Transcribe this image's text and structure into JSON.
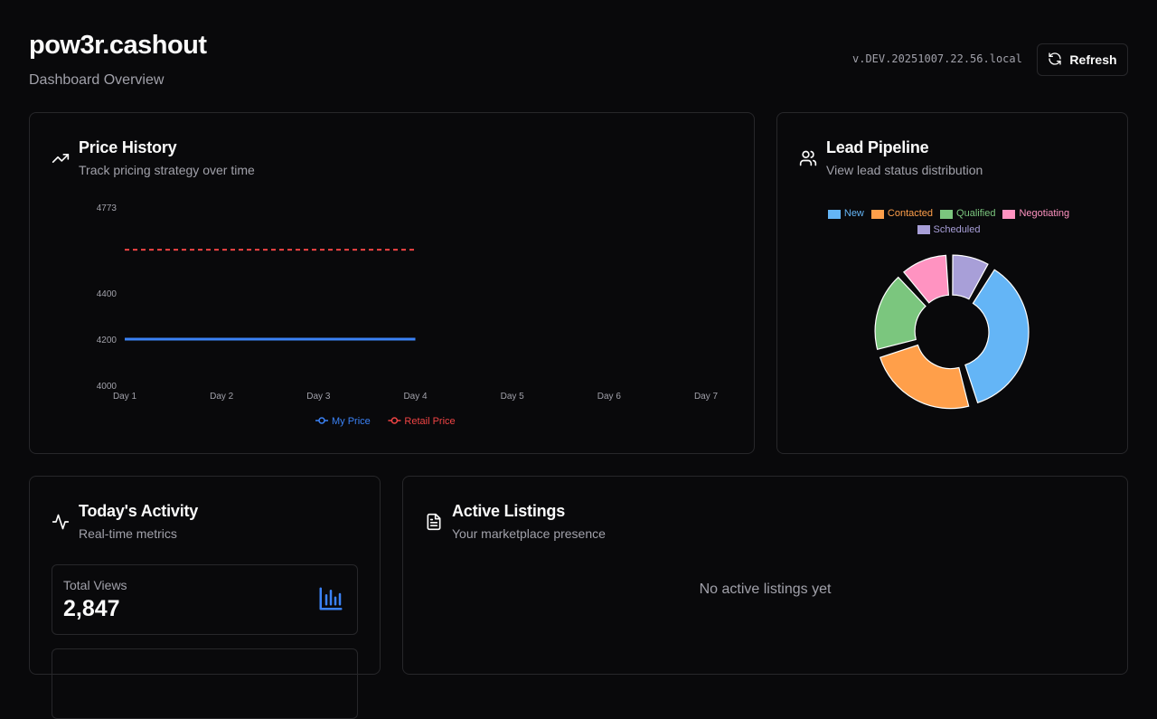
{
  "app": {
    "title": "pow3r.cashout",
    "subtitle": "Dashboard Overview",
    "version": "v.DEV.20251007.22.56.local",
    "refresh_label": "Refresh"
  },
  "price_history": {
    "title": "Price History",
    "description": "Track pricing strategy over time",
    "icon": "trending-up-icon"
  },
  "lead_pipeline": {
    "title": "Lead Pipeline",
    "description": "View lead status distribution",
    "icon": "users-icon"
  },
  "todays_activity": {
    "title": "Today's Activity",
    "description": "Real-time metrics",
    "icon": "activity-icon",
    "metrics": [
      {
        "label": "Total Views",
        "value": "2,847",
        "icon": "bar-chart-icon"
      }
    ]
  },
  "active_listings": {
    "title": "Active Listings",
    "description": "Your marketplace presence",
    "icon": "file-text-icon",
    "empty_text": "No active listings yet"
  },
  "colors": {
    "accent_blue": "#3b82f6",
    "accent_red": "#ef4444"
  },
  "chart_data": [
    {
      "type": "line",
      "categories": [
        "Day 1",
        "Day 2",
        "Day 3",
        "Day 4",
        "Day 5",
        "Day 6",
        "Day 7"
      ],
      "yticks": [
        4000,
        4200,
        4400,
        4773
      ],
      "ylim": [
        4000,
        4773
      ],
      "series": [
        {
          "name": "My Price",
          "values": [
            4200,
            4200,
            4200,
            4200
          ],
          "color": "#3b82f6",
          "style": "solid"
        },
        {
          "name": "Retail Price",
          "values": [
            4588,
            4588,
            4588,
            4588
          ],
          "color": "#ef4444",
          "style": "dashed"
        }
      ],
      "legend": "bottom",
      "grid": false
    },
    {
      "type": "pie",
      "variant": "donut",
      "labels": [
        "New",
        "Contacted",
        "Qualified",
        "Negotiating",
        "Scheduled"
      ],
      "values": [
        37,
        25,
        18,
        11,
        9
      ],
      "colors": [
        "#64b5f6",
        "#ff9f4a",
        "#7bc67e",
        "#ff93c1",
        "#a89fd8"
      ],
      "legend": "top"
    }
  ]
}
